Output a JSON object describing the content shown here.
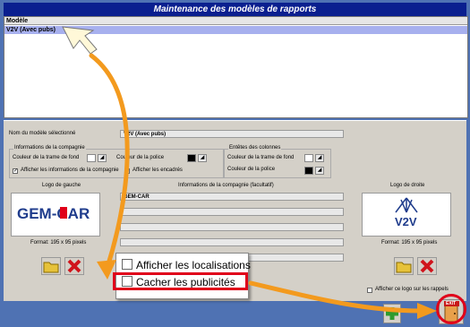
{
  "window": {
    "title": "Maintenance des modèles de rapports"
  },
  "list": {
    "column_header": "Modèle",
    "selected_row": "V2V (Avec pubs)"
  },
  "form": {
    "model_name_label": "Nom du modèle sélectionné",
    "model_name_value": "V2V (Avec pubs)",
    "company_group": {
      "title": "Informations de la compagnie",
      "bg_color_label": "Couleur de la trame de fond",
      "font_color_label": "Couleur de la police",
      "show_info_label": "Afficher les informations de la compagnie",
      "show_info_checked": true,
      "show_frames_label": "Afficher les encadrés",
      "show_frames_checked": false
    },
    "column_group": {
      "title": "Entêtes des colonnes",
      "bg_color_label": "Couleur de la trame de fond",
      "font_color_label": "Couleur de la police"
    },
    "left_logo": {
      "label": "Logo de gauche",
      "logo_text": "GEM-CAR",
      "format": "Format: 195 x 95 pixels"
    },
    "company_info": {
      "label": "Informations de la compagnie (facultatif)",
      "lines": [
        "GEM-CAR",
        "",
        "",
        "",
        ""
      ]
    },
    "right_logo": {
      "label": "Logo de droite",
      "logo_text": "V2V",
      "format": "Format: 195 x 95 pixels"
    },
    "show_logo_reminders": {
      "label": "Afficher ce logo sur les rappels",
      "checked": false
    }
  },
  "callout": {
    "show_locations": {
      "label": "Afficher les localisations",
      "checked": false
    },
    "hide_ads": {
      "label": "Cacher les publicités",
      "checked": false
    }
  },
  "footer": {
    "exit_label": "EXIT"
  },
  "colors": {
    "title_bar": "#0a1f8f",
    "selected_row": "#a7b0ee",
    "panel": "#d4d0c8",
    "arrow": "#f39a1e",
    "highlight": "#e0001a"
  }
}
